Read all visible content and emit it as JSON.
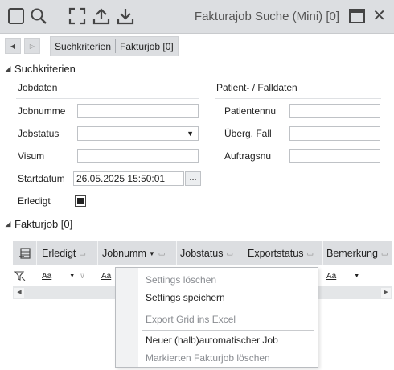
{
  "window": {
    "title": "Fakturajob Suche (Mini) [0]",
    "close_glyph": "✕"
  },
  "toolbar": {
    "icons": [
      "select-mode-icon",
      "search-icon",
      "fullscreen-icon",
      "upload-icon",
      "download-icon"
    ]
  },
  "breadcrumb": {
    "items": [
      "Suchkriterien",
      "Fakturjob [0]"
    ]
  },
  "search_section": {
    "title": "Suchkriterien",
    "job_group": {
      "title": "Jobdaten",
      "fields": {
        "jobnummer_label": "Jobnumme",
        "jobnummer_value": "",
        "jobstatus_label": "Jobstatus",
        "jobstatus_value": "",
        "visum_label": "Visum",
        "visum_value": "",
        "startdatum_label": "Startdatum",
        "startdatum_value": "26.05.2025 15:50:01",
        "startdatum_button": "...",
        "erledigt_label": "Erledigt",
        "erledigt_checked": true
      }
    },
    "patient_group": {
      "title": "Patient- / Falldaten",
      "fields": {
        "patientennummer_label": "Patientennu",
        "patientennummer_value": "",
        "uebergeordneter_fall_label": "Überg. Fall",
        "uebergeordneter_fall_value": "",
        "auftragsnummer_label": "Auftragsnu",
        "auftragsnummer_value": ""
      }
    }
  },
  "results_section": {
    "title": "Fakturjob [0]",
    "columns": [
      {
        "label": "Erledigt"
      },
      {
        "label": "Jobnumm"
      },
      {
        "label": "Jobstatus"
      },
      {
        "label": "Exportstatus"
      },
      {
        "label": "Bemerkung"
      }
    ],
    "filter_placeholder": "Aa"
  },
  "context_menu": {
    "items": [
      {
        "label": "Settings löschen",
        "enabled": false
      },
      {
        "label": "Settings speichern",
        "enabled": true
      },
      {
        "label": "Export Grid ins Excel",
        "enabled": false
      },
      {
        "label": "Neuer (halb)automatischer Job",
        "enabled": true
      },
      {
        "label": "Markierten Fakturjob löschen",
        "enabled": false
      }
    ]
  },
  "colors": {
    "toolbar_bg": "#dcdee1",
    "grid_header_bg": "#dcdee1",
    "disabled_text": "#8a8d92"
  }
}
